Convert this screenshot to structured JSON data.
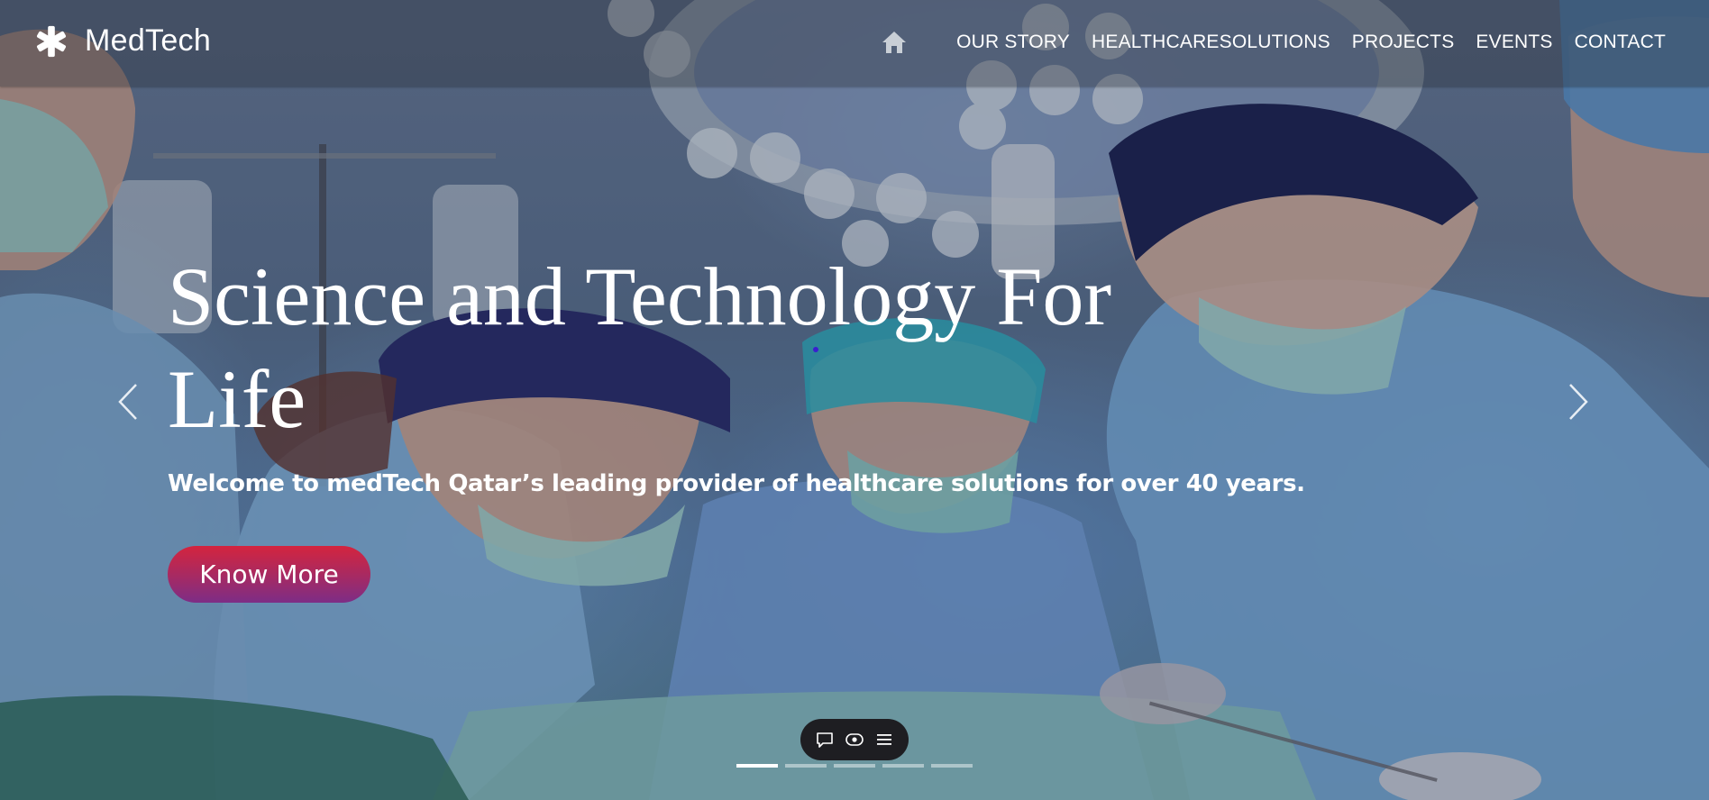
{
  "brand": {
    "name": "MedTech",
    "icon": "asterisk-icon"
  },
  "nav": {
    "home_icon": "home-icon",
    "items": [
      {
        "label": "OUR STORY"
      },
      {
        "label": "HEALTHCARESOLUTIONS"
      },
      {
        "label": "PROJECTS"
      },
      {
        "label": "EVENTS"
      },
      {
        "label": "CONTACT"
      }
    ]
  },
  "hero": {
    "title_line1": "Science and Technology For",
    "title_line2": "Life",
    "subtitle": "Welcome to medTech Qatar’s leading provider of healthcare solutions for over 40 years.",
    "cta_label": "Know More"
  },
  "carousel": {
    "prev_icon": "chevron-left-icon",
    "next_icon": "chevron-right-icon",
    "slide_count": 5,
    "active_index": 0
  },
  "toolbar": {
    "icons": [
      "comment-icon",
      "eye-icon",
      "menu-icon"
    ]
  },
  "colors": {
    "cta_gradient_top": "#d4243e",
    "cta_gradient_bottom": "#7d2d86",
    "toolbar_bg": "#1e1e22",
    "text": "#ffffff"
  }
}
